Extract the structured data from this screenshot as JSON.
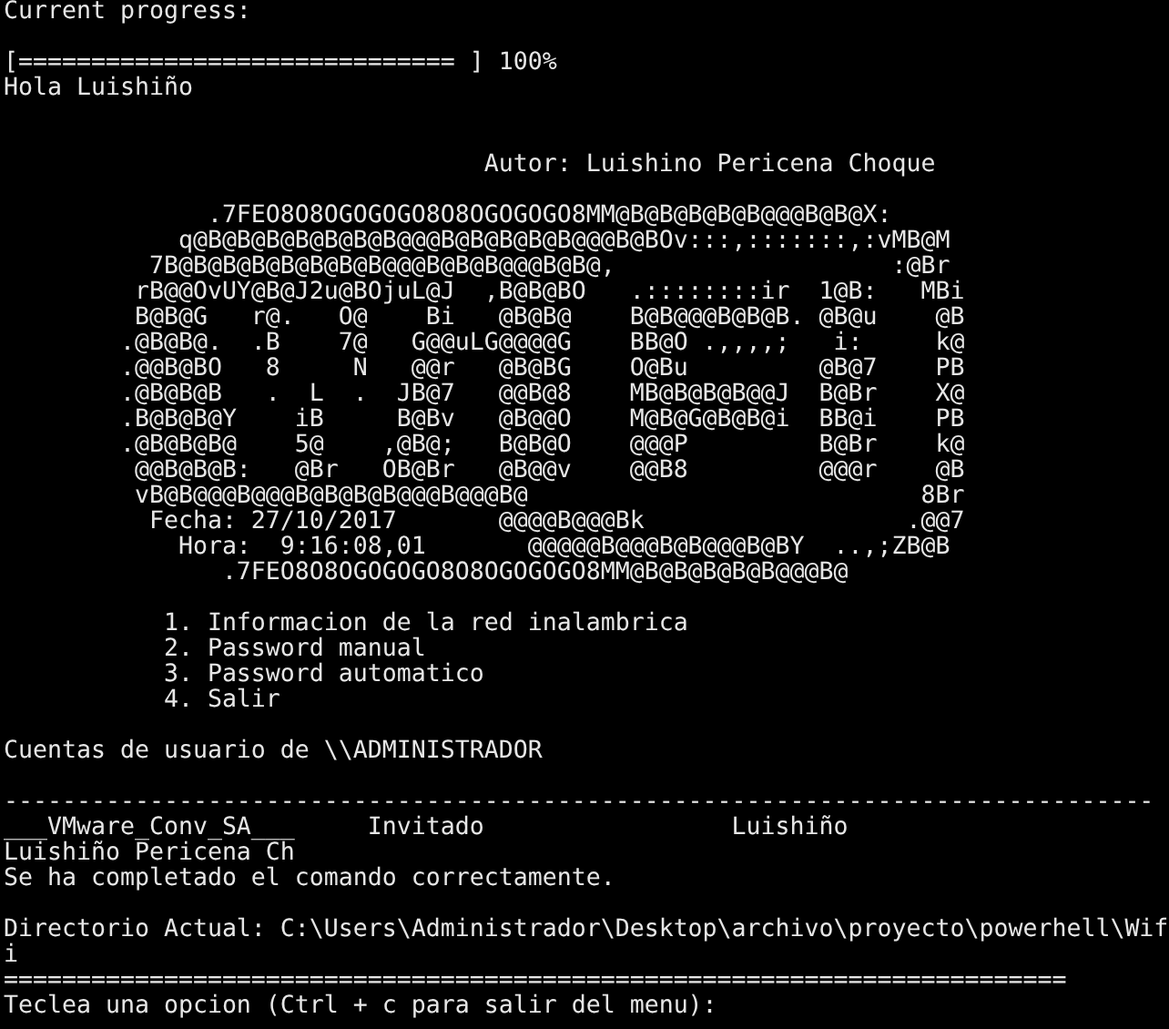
{
  "console": {
    "lines": [
      {
        "kind": "text",
        "text": "Current progress:"
      },
      {
        "kind": "blank"
      },
      {
        "kind": "text",
        "text": "[============================== ] 100%"
      },
      {
        "kind": "text",
        "text": "Hola Luishiño"
      },
      {
        "kind": "blank"
      },
      {
        "kind": "blank"
      },
      {
        "kind": "text",
        "text": "                                 Autor: Luishino Pericena Choque"
      },
      {
        "kind": "blank"
      },
      {
        "kind": "art",
        "text": "              .7FEO8O8OGOGOGO8O8OGOGOGO8MM@B@B@B@B@B@@@B@B@X:"
      },
      {
        "kind": "art",
        "text": "            q@B@B@B@B@B@B@B@@@B@B@B@B@B@@@B@BOv:::,:::::::,:vMB@M"
      },
      {
        "kind": "art",
        "text": "          7B@B@B@B@B@B@B@B@@@B@B@B@@@B@B@,                   :@Br"
      },
      {
        "kind": "art",
        "text": "         rB@@OvUY@B@J2u@BOjuL@J  ,B@B@BO   .::::::::ir  1@B:   MBi"
      },
      {
        "kind": "art",
        "text": "         B@B@G   r@.   O@    Bi   @B@B@    B@B@@@B@B@B. @B@u    @B"
      },
      {
        "kind": "art",
        "text": "        .@B@B@.  .B    7@   G@@uLG@@@@G    BB@O .,,,,;   i:     k@"
      },
      {
        "kind": "art",
        "text": "        .@@B@BO   8     N   @@r   @B@BG    O@Bu         @B@7    PB"
      },
      {
        "kind": "art",
        "text": "        .@B@B@B   .  L  .  JB@7   @@B@8    MB@B@B@B@@J  B@Br    X@"
      },
      {
        "kind": "art",
        "text": "        .B@B@B@Y    iB     B@Bv   @B@@O    M@B@G@B@B@i  BB@i    PB"
      },
      {
        "kind": "art",
        "text": "        .@B@B@B@    5@    ,@B@;   B@B@O    @@@P         B@Br    k@"
      },
      {
        "kind": "art",
        "text": "         @@B@B@B:   @Br   OB@Br   @B@@v    @@B8         @@@r    @B"
      },
      {
        "kind": "art",
        "text": "         vB@B@@@B@@@B@B@B@B@@@B@@@B@                           8Br"
      },
      {
        "kind": "art",
        "text": "          Fecha: 27/10/2017       @@@@B@@@Bk                  .@@7"
      },
      {
        "kind": "art",
        "text": "            Hora:  9:16:08,01       @@@@@B@@@B@B@@@B@BY  ..,;ZB@B"
      },
      {
        "kind": "art",
        "text": "               .7FEO8O8OGOGOGO8O8OGOGOGO8MM@B@B@B@B@B@@@B@"
      },
      {
        "kind": "blank"
      },
      {
        "kind": "menu",
        "text": "           1. Informacion de la red inalambrica"
      },
      {
        "kind": "menu",
        "text": "           2. Password manual"
      },
      {
        "kind": "menu",
        "text": "           3. Password automatico"
      },
      {
        "kind": "menu",
        "text": "           4. Salir"
      },
      {
        "kind": "blank"
      },
      {
        "kind": "text",
        "text": "Cuentas de usuario de \\\\ADMINISTRADOR"
      },
      {
        "kind": "blank"
      },
      {
        "kind": "rule",
        "text": "-------------------------------------------------------------------------------"
      },
      {
        "kind": "text",
        "text": "___VMware_Conv_SA___     Invitado                 Luishiño"
      },
      {
        "kind": "text",
        "text": "Luishiño Pericena Ch"
      },
      {
        "kind": "text",
        "text": "Se ha completado el comando correctamente."
      },
      {
        "kind": "blank"
      },
      {
        "kind": "text",
        "text": "Directorio Actual: C:\\Users\\Administrador\\Desktop\\archivo\\proyecto\\powerhell\\Wif"
      },
      {
        "kind": "text",
        "text": "i"
      },
      {
        "kind": "rule",
        "text": "========================================================================="
      },
      {
        "kind": "text",
        "text": "Teclea una opcion (Ctrl + c para salir del menu):"
      }
    ]
  }
}
